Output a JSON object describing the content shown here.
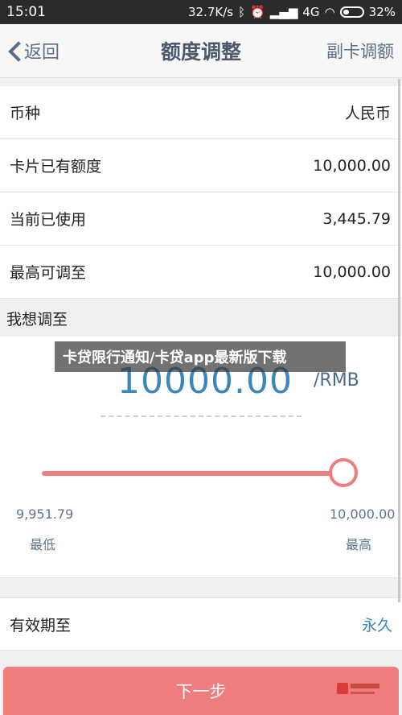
{
  "status": {
    "time": "15:01",
    "speed": "32.7K/s",
    "network": "4G",
    "battery": "32%"
  },
  "nav": {
    "back_label": "返回",
    "title": "额度调整",
    "right_label": "副卡调额"
  },
  "rows": [
    {
      "label": "币种",
      "value": "人民币"
    },
    {
      "label": "卡片已有额度",
      "value": "10,000.00"
    },
    {
      "label": "当前已使用",
      "value": "3,445.79"
    },
    {
      "label": "最高可调至",
      "value": "10,000.00"
    }
  ],
  "adjust": {
    "section_label": "我想调至",
    "amount": "10000.00",
    "unit": "/RMB",
    "slider_level": 1.0,
    "min_value": "9,951.79",
    "max_value": "10,000.00",
    "min_label": "最低",
    "max_label": "最高"
  },
  "expire": {
    "label": "有效期至",
    "value": "永久"
  },
  "next_button": "下一步",
  "watermark": "卡贷限行通知/卡贷app最新版下载",
  "colors": {
    "accent": "#f07d7d",
    "link": "#3c86b9",
    "status_bar": "#2b2b2b"
  }
}
